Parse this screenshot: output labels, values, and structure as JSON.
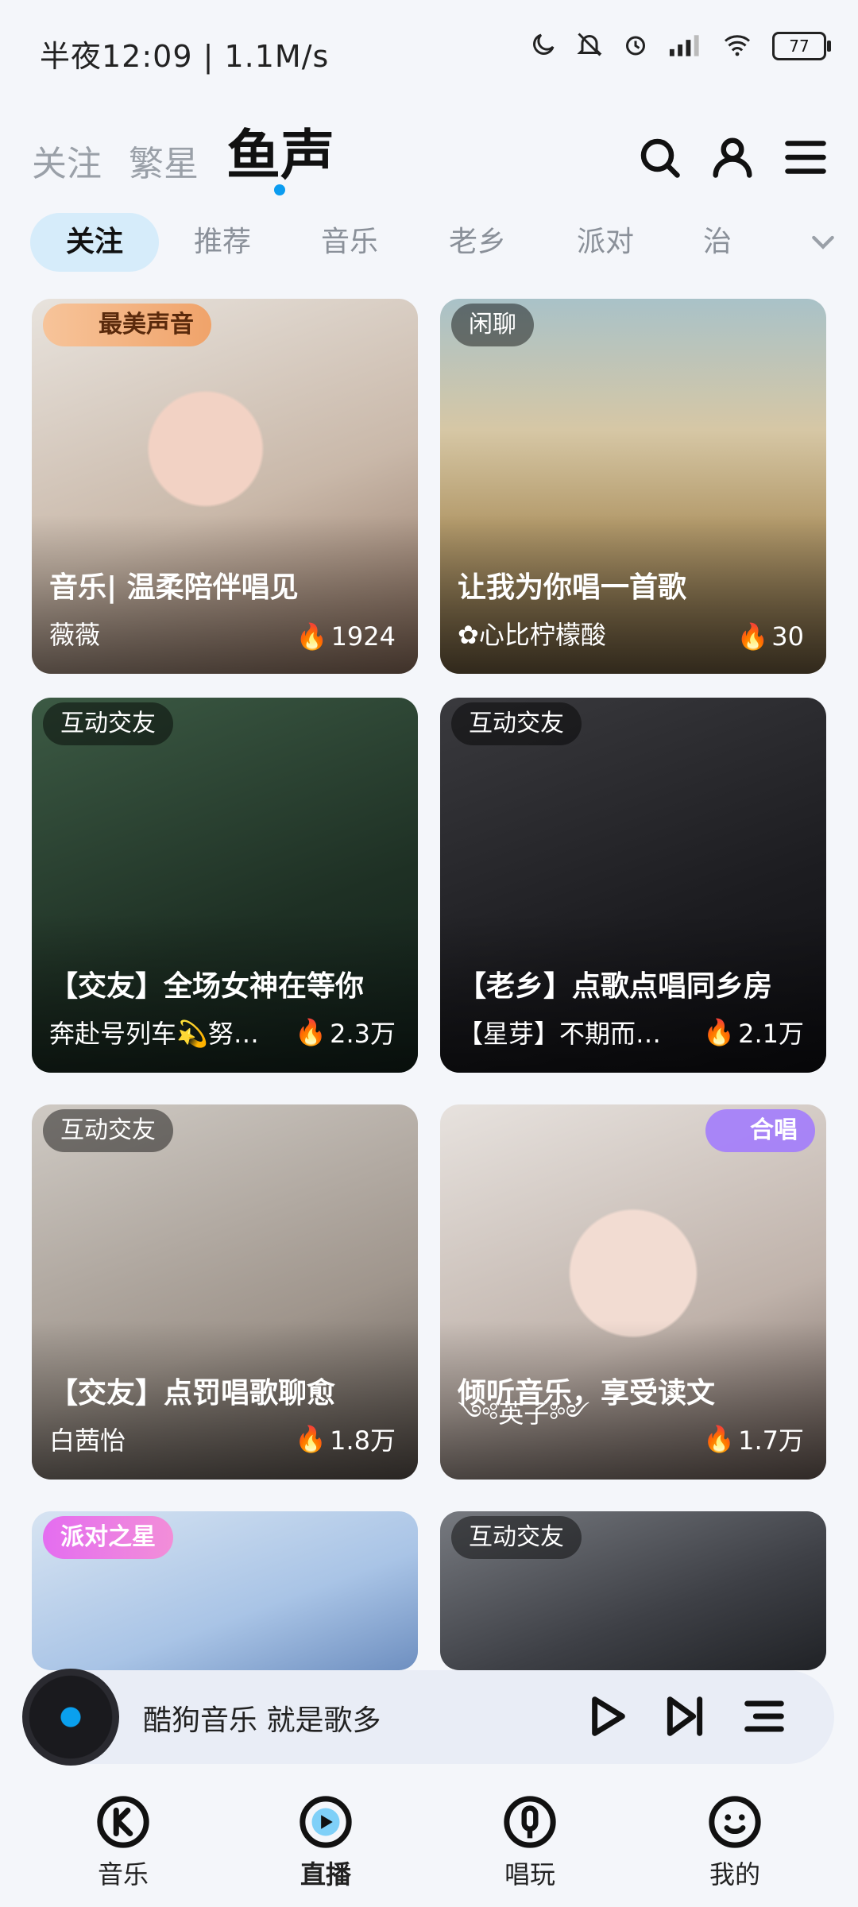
{
  "status": {
    "time": "半夜12:09 | 1.1M/s",
    "battery": "77"
  },
  "topnav": {
    "tabs": [
      "关注",
      "繁星",
      "鱼声"
    ],
    "active": "鱼声"
  },
  "chips": [
    "关注",
    "推荐",
    "音乐",
    "老乡",
    "派对",
    "治"
  ],
  "cards": [
    {
      "badge": "最美声音",
      "title": "音乐| 温柔陪伴唱见",
      "host": "薇薇",
      "heat": "1924"
    },
    {
      "badge": "闲聊",
      "title": "让我为你唱一首歌",
      "host": "✿心比柠檬酸",
      "heat": "30"
    },
    {
      "badge": "互动交友",
      "title": "【交友】全场女神在等你",
      "host": "奔赴号列车💫努…",
      "heat": "2.3万"
    },
    {
      "badge": "互动交友",
      "title": "【老乡】点歌点唱同乡房",
      "host": "【星芽】不期而…",
      "heat": "2.1万"
    },
    {
      "badge": "互动交友",
      "title": "【交友】点罚唱歌聊愈",
      "host": "白茜怡",
      "heat": "1.8万"
    },
    {
      "badge": "合唱",
      "title": "倾听音乐，享受读文",
      "host": "༺英子༻",
      "heat": "1.7万"
    },
    {
      "badge": "派对之星",
      "title": "",
      "host": "",
      "heat": ""
    },
    {
      "badge": "互动交友",
      "title": "",
      "host": "",
      "heat": ""
    }
  ],
  "player": {
    "text": "酷狗音乐  就是歌多"
  },
  "bottomnav": [
    "音乐",
    "直播",
    "唱玩",
    "我的"
  ],
  "colors": {
    "accent": "#0b9cf0",
    "chip_active_bg": "#d6ecfa"
  }
}
